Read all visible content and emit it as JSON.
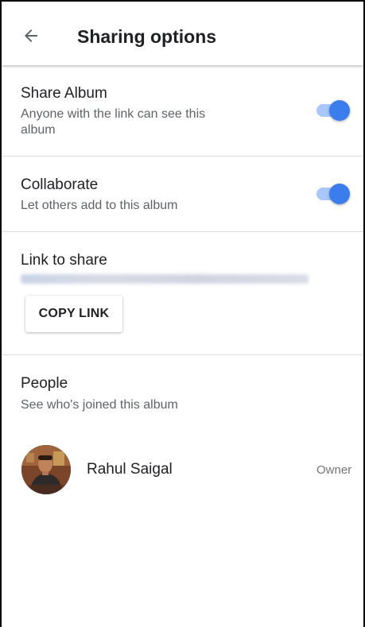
{
  "header": {
    "title": "Sharing options"
  },
  "share_album": {
    "title": "Share Album",
    "subtitle_line1": "Anyone with the link can see this",
    "subtitle_line2": "album",
    "enabled": true
  },
  "collaborate": {
    "title": "Collaborate",
    "subtitle": "Let others add to this album",
    "enabled": true
  },
  "link": {
    "title": "Link to share",
    "copy_label": "COPY LINK"
  },
  "people": {
    "title": "People",
    "subtitle": "See who's joined this album",
    "members": [
      {
        "name": "Rahul Saigal",
        "role": "Owner"
      }
    ]
  },
  "colors": {
    "accent": "#3b7ded",
    "track": "#a8c7fa"
  }
}
